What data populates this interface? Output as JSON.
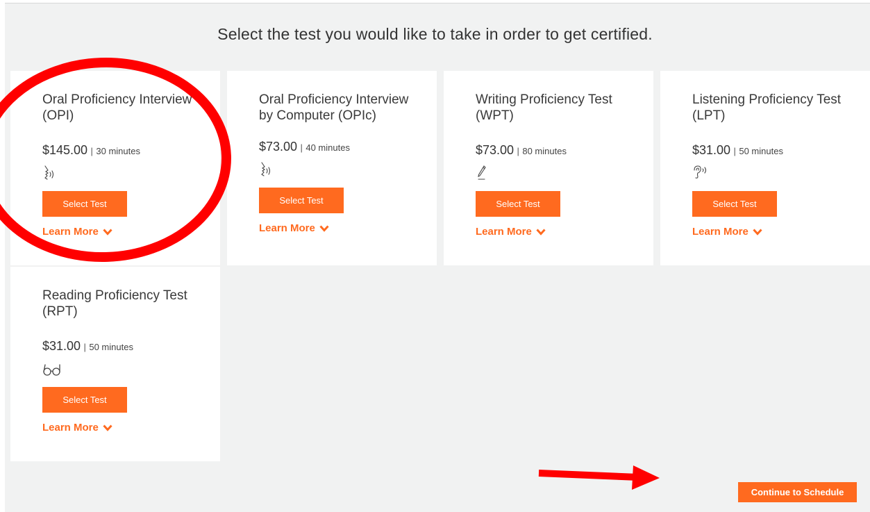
{
  "heading": "Select the test you would like to take in order to get certified.",
  "tests": [
    {
      "title": "Oral Proficiency Interview (OPI)",
      "price": "$145.00",
      "duration": "30 minutes",
      "icon": "speaking-icon",
      "select_label": "Select Test",
      "learn_label": "Learn More"
    },
    {
      "title": "Oral Proficiency Interview by Computer (OPIc)",
      "price": "$73.00",
      "duration": "40 minutes",
      "icon": "speaking-icon",
      "select_label": "Select Test",
      "learn_label": "Learn More"
    },
    {
      "title": "Writing Proficiency Test (WPT)",
      "price": "$73.00",
      "duration": "80 minutes",
      "icon": "pencil-icon",
      "select_label": "Select Test",
      "learn_label": "Learn More"
    },
    {
      "title": "Listening Proficiency Test (LPT)",
      "price": "$31.00",
      "duration": "50 minutes",
      "icon": "listening-icon",
      "select_label": "Select Test",
      "learn_label": "Learn More"
    },
    {
      "title": "Reading Proficiency Test (RPT)",
      "price": "$31.00",
      "duration": "50 minutes",
      "icon": "glasses-icon",
      "select_label": "Select Test",
      "learn_label": "Learn More"
    }
  ],
  "separator": "|",
  "continue_label": "Continue to Schedule",
  "colors": {
    "accent": "#ff6a1f",
    "annotation": "#ff0000",
    "background": "#f1f2f2"
  }
}
